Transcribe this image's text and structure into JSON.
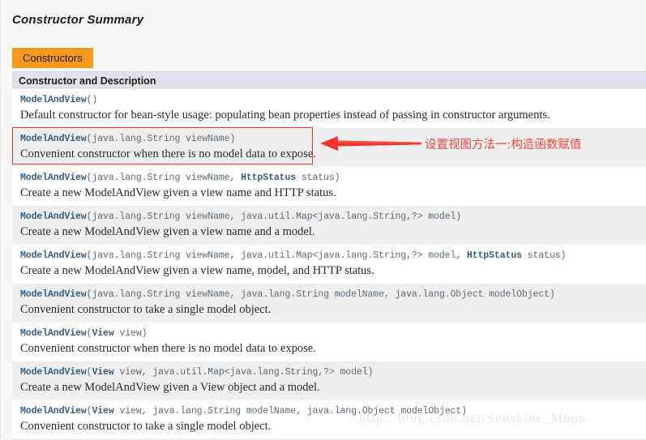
{
  "page": {
    "title": "Constructor Summary",
    "background_color": "#f7f7f7"
  },
  "tab": {
    "label": "Constructors",
    "color": "#f8981d"
  },
  "table": {
    "column_header": "Constructor and Description",
    "header_color": "#dee3e9",
    "rows": [
      {
        "link": "ModelAndView",
        "signature": "()",
        "description": "Default constructor for bean-style usage: populating bean properties instead of passing in constructor arguments."
      },
      {
        "link": "ModelAndView",
        "signature": "(java.lang.String  viewName)",
        "description": "Convenient constructor when there is no model data to expose."
      },
      {
        "link": "ModelAndView",
        "signature_pre": "(java.lang.String  viewName, ",
        "link2": "HttpStatus",
        "signature_post": "  status)",
        "description": "Create a new ModelAndView given a view name and HTTP status."
      },
      {
        "link": "ModelAndView",
        "signature": "(java.lang.String  viewName, java.util.Map<java.lang.String,?>  model)",
        "description": "Create a new ModelAndView given a view name and a model."
      },
      {
        "link": "ModelAndView",
        "signature_pre": "(java.lang.String  viewName, java.util.Map<java.lang.String,?>  model, ",
        "link2": "HttpStatus",
        "signature_post": "  status)",
        "description": "Create a new ModelAndView given a view name, model, and HTTP status."
      },
      {
        "link": "ModelAndView",
        "signature": "(java.lang.String  viewName, java.lang.String  modelName, java.lang.Object  modelObject)",
        "description": "Convenient constructor to take a single model object."
      },
      {
        "link": "ModelAndView",
        "signature_pre": "(",
        "link2": "View",
        "signature_post": "  view)",
        "description": "Convenient constructor when there is no model data to expose."
      },
      {
        "link": "ModelAndView",
        "signature_pre": "(",
        "link2": "View",
        "signature_post": "  view, java.util.Map<java.lang.String,?>  model)",
        "description": "Create a new ModelAndView given a View object and a model."
      },
      {
        "link": "ModelAndView",
        "signature_pre": "(",
        "link2": "View",
        "signature_post": "  view, java.lang.String  modelName, java.lang.Object  modelObject)",
        "description": "Convenient constructor to take a single model object."
      }
    ]
  },
  "annotation": {
    "text": "设置视图方法一:构造函数赋值",
    "color": "#f4443c",
    "highlight_border_color": "#e8332f"
  },
  "watermark": {
    "text": "http://blog.csdn.net/Sunshine_Moon"
  }
}
